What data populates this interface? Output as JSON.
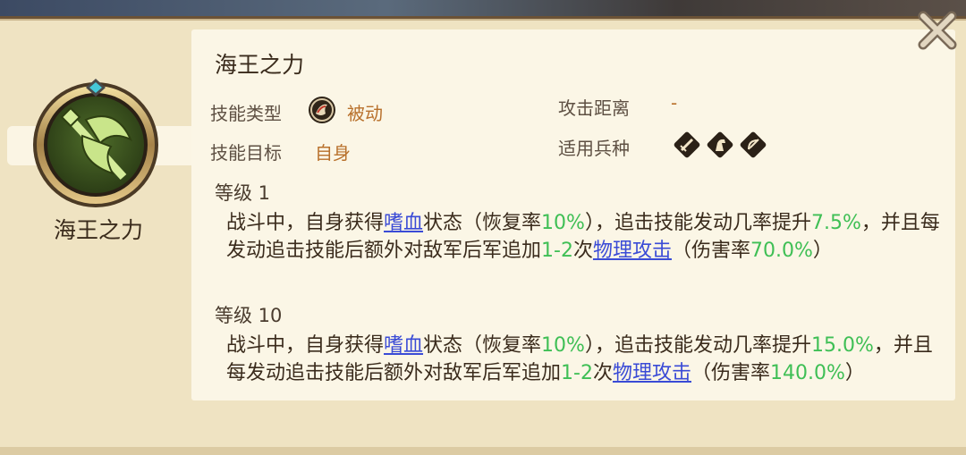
{
  "skill": {
    "name": "海王之力",
    "side_name": "海王之力"
  },
  "info": {
    "type_label": "技能类型",
    "type_value": "被动",
    "target_label": "技能目标",
    "target_value": "自身",
    "range_label": "攻击距离",
    "range_value": "-",
    "troop_label": "适用兵种",
    "troop_icons": [
      "sword-troop-icon",
      "horse-troop-icon",
      "bow-troop-icon"
    ]
  },
  "levels": [
    {
      "label": "等级 1",
      "parts": {
        "p1": "战斗中，自身获得",
        "link1": "嗜血",
        "p2": "状态（恢复率",
        "g1": "10%",
        "p3": "），追击技能发动几率提升",
        "g2": "7.5%",
        "p4": "，并且每发动追击技能后额外对敌军后军追加",
        "g3": "1-2",
        "p5": "次",
        "link2": "物理攻击",
        "p6": "（伤害率",
        "g4": "70.0%",
        "p7": "）"
      }
    },
    {
      "label": "等级 10",
      "parts": {
        "p1": "战斗中，自身获得",
        "link1": "嗜血",
        "p2": "状态（恢复率",
        "g1": "10%",
        "p3": "），追击技能发动几率提升",
        "g2": "15.0%",
        "p4": "，并且每发动追击技能后额外对敌军后军追加",
        "g3": "1-2",
        "p5": "次",
        "link2": "物理攻击",
        "p6": "（伤害率",
        "g4": "140.0%",
        "p7": "）"
      }
    }
  ],
  "colors": {
    "accent_value": "#b8702b",
    "highlight_green": "#3fbf55",
    "link_blue": "#3a4bd6"
  }
}
